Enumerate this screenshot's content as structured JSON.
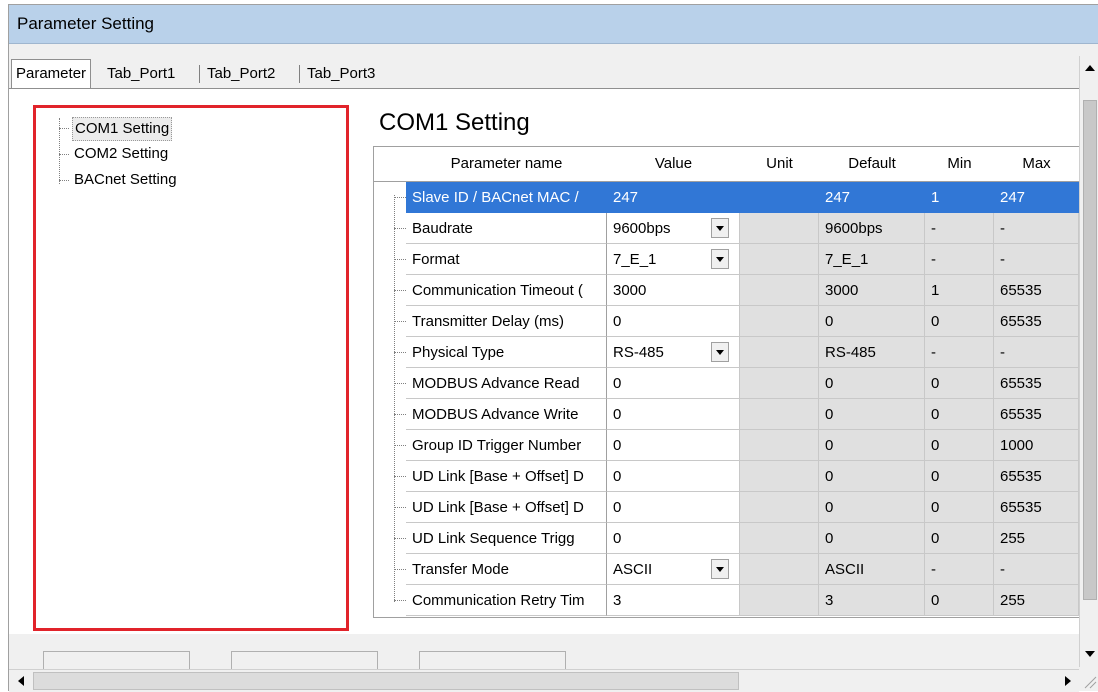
{
  "window": {
    "title": "Parameter Setting"
  },
  "tabs": [
    {
      "label": "Parameter",
      "active": true
    },
    {
      "label": "Tab_Port1",
      "active": false
    },
    {
      "label": "Tab_Port2",
      "active": false
    },
    {
      "label": "Tab_Port3",
      "active": false
    }
  ],
  "tree": {
    "items": [
      {
        "label": "COM1 Setting",
        "selected": true
      },
      {
        "label": "COM2 Setting",
        "selected": false
      },
      {
        "label": "BACnet Setting",
        "selected": false
      }
    ]
  },
  "section": {
    "title": "COM1 Setting"
  },
  "grid": {
    "headers": [
      "Parameter name",
      "Value",
      "Unit",
      "Default",
      "Min",
      "Max"
    ],
    "rows": [
      {
        "name": "Slave ID / BACnet MAC /",
        "value": "247",
        "dropdown": false,
        "unit": "",
        "default": "247",
        "min": "1",
        "max": "247",
        "selected": true
      },
      {
        "name": "Baudrate",
        "value": "9600bps",
        "dropdown": true,
        "unit": "",
        "default": "9600bps",
        "min": "-",
        "max": "-"
      },
      {
        "name": "Format",
        "value": "7_E_1",
        "dropdown": true,
        "unit": "",
        "default": "7_E_1",
        "min": "-",
        "max": "-"
      },
      {
        "name": "Communication Timeout (",
        "value": "3000",
        "dropdown": false,
        "unit": "",
        "default": "3000",
        "min": "1",
        "max": "65535"
      },
      {
        "name": "Transmitter Delay (ms)",
        "value": "0",
        "dropdown": false,
        "unit": "",
        "default": "0",
        "min": "0",
        "max": "65535"
      },
      {
        "name": "Physical Type",
        "value": "RS-485",
        "dropdown": true,
        "unit": "",
        "default": "RS-485",
        "min": "-",
        "max": "-"
      },
      {
        "name": "MODBUS Advance Read",
        "value": "0",
        "dropdown": false,
        "unit": "",
        "default": "0",
        "min": "0",
        "max": "65535"
      },
      {
        "name": "MODBUS Advance Write",
        "value": "0",
        "dropdown": false,
        "unit": "",
        "default": "0",
        "min": "0",
        "max": "65535"
      },
      {
        "name": "Group ID Trigger Number",
        "value": "0",
        "dropdown": false,
        "unit": "",
        "default": "0",
        "min": "0",
        "max": "1000"
      },
      {
        "name": "UD Link [Base + Offset] D",
        "value": "0",
        "dropdown": false,
        "unit": "",
        "default": "0",
        "min": "0",
        "max": "65535"
      },
      {
        "name": "UD Link [Base + Offset] D",
        "value": "0",
        "dropdown": false,
        "unit": "",
        "default": "0",
        "min": "0",
        "max": "65535"
      },
      {
        "name": "UD Link Sequence Trigg",
        "value": "0",
        "dropdown": false,
        "unit": "",
        "default": "0",
        "min": "0",
        "max": "255"
      },
      {
        "name": "Transfer Mode",
        "value": "ASCII",
        "dropdown": true,
        "unit": "",
        "default": "ASCII",
        "min": "-",
        "max": "-"
      },
      {
        "name": "Communication Retry Tim",
        "value": "3",
        "dropdown": false,
        "unit": "",
        "default": "3",
        "min": "0",
        "max": "255"
      }
    ]
  },
  "colors": {
    "titlebar": "#b9d1ea",
    "selection": "#3177d6",
    "highlight_border": "#e1232a"
  }
}
